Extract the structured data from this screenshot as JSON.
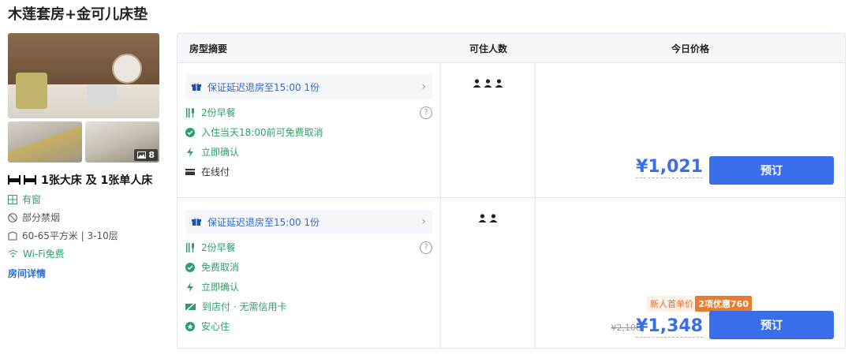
{
  "hotel_room": {
    "title": "木莲套房+金可儿床垫",
    "photo_count": "8",
    "bed": "1张大床 及 1张单人床",
    "features": [
      {
        "icon": "window-icon",
        "text": "有窗",
        "color": "#2e9f6a"
      },
      {
        "icon": "no-smoking-icon",
        "text": "部分禁烟",
        "color": "#555555"
      },
      {
        "icon": "area-icon",
        "text": "60-65平方米 | 3-10层",
        "color": "#555555"
      },
      {
        "icon": "wifi-icon",
        "text": "Wi-Fi免费",
        "color": "#2e9f6a"
      }
    ],
    "detail_link": "房间详情"
  },
  "table": {
    "headers": [
      "房型摘要",
      "可住人数",
      "今日价格"
    ],
    "rows": [
      {
        "perk": "保证延迟退房至15:00 1份",
        "items": [
          {
            "icon": "breakfast-icon",
            "text": "2份早餐",
            "color": "#2e9f6a",
            "help": true
          },
          {
            "icon": "check-circle-icon",
            "text": "入住当天18:00前可免费取消",
            "color": "#2e9f6a"
          },
          {
            "icon": "lightning-icon",
            "text": "立即确认",
            "color": "#2e9f6a"
          },
          {
            "icon": "card-icon",
            "text": "在线付",
            "color": "#333333"
          }
        ],
        "guests": 3,
        "price": "¥1,021",
        "book_label": "预订"
      },
      {
        "perk": "保证延迟退房至15:00 1份",
        "items": [
          {
            "icon": "breakfast-icon",
            "text": "2份早餐",
            "color": "#2e9f6a",
            "help": true
          },
          {
            "icon": "check-circle-icon",
            "text": "免费取消",
            "color": "#2e9f6a"
          },
          {
            "icon": "lightning-icon",
            "text": "立即确认",
            "color": "#2e9f6a"
          },
          {
            "icon": "pay-at-hotel-icon",
            "text": "到店付 · 无需信用卡",
            "color": "#2e9f6a"
          },
          {
            "icon": "shield-icon",
            "text": "安心住",
            "color": "#2e9f6a"
          }
        ],
        "guests": 2,
        "new_user_tag": "新人首单价",
        "discount_tag": "2项优惠760",
        "original_price": "¥2,108",
        "price": "¥1,348",
        "book_label": "预订"
      }
    ]
  },
  "colors": {
    "accent": "#3a6de8",
    "green": "#2e9f6a",
    "orange": "#e87b2c"
  }
}
